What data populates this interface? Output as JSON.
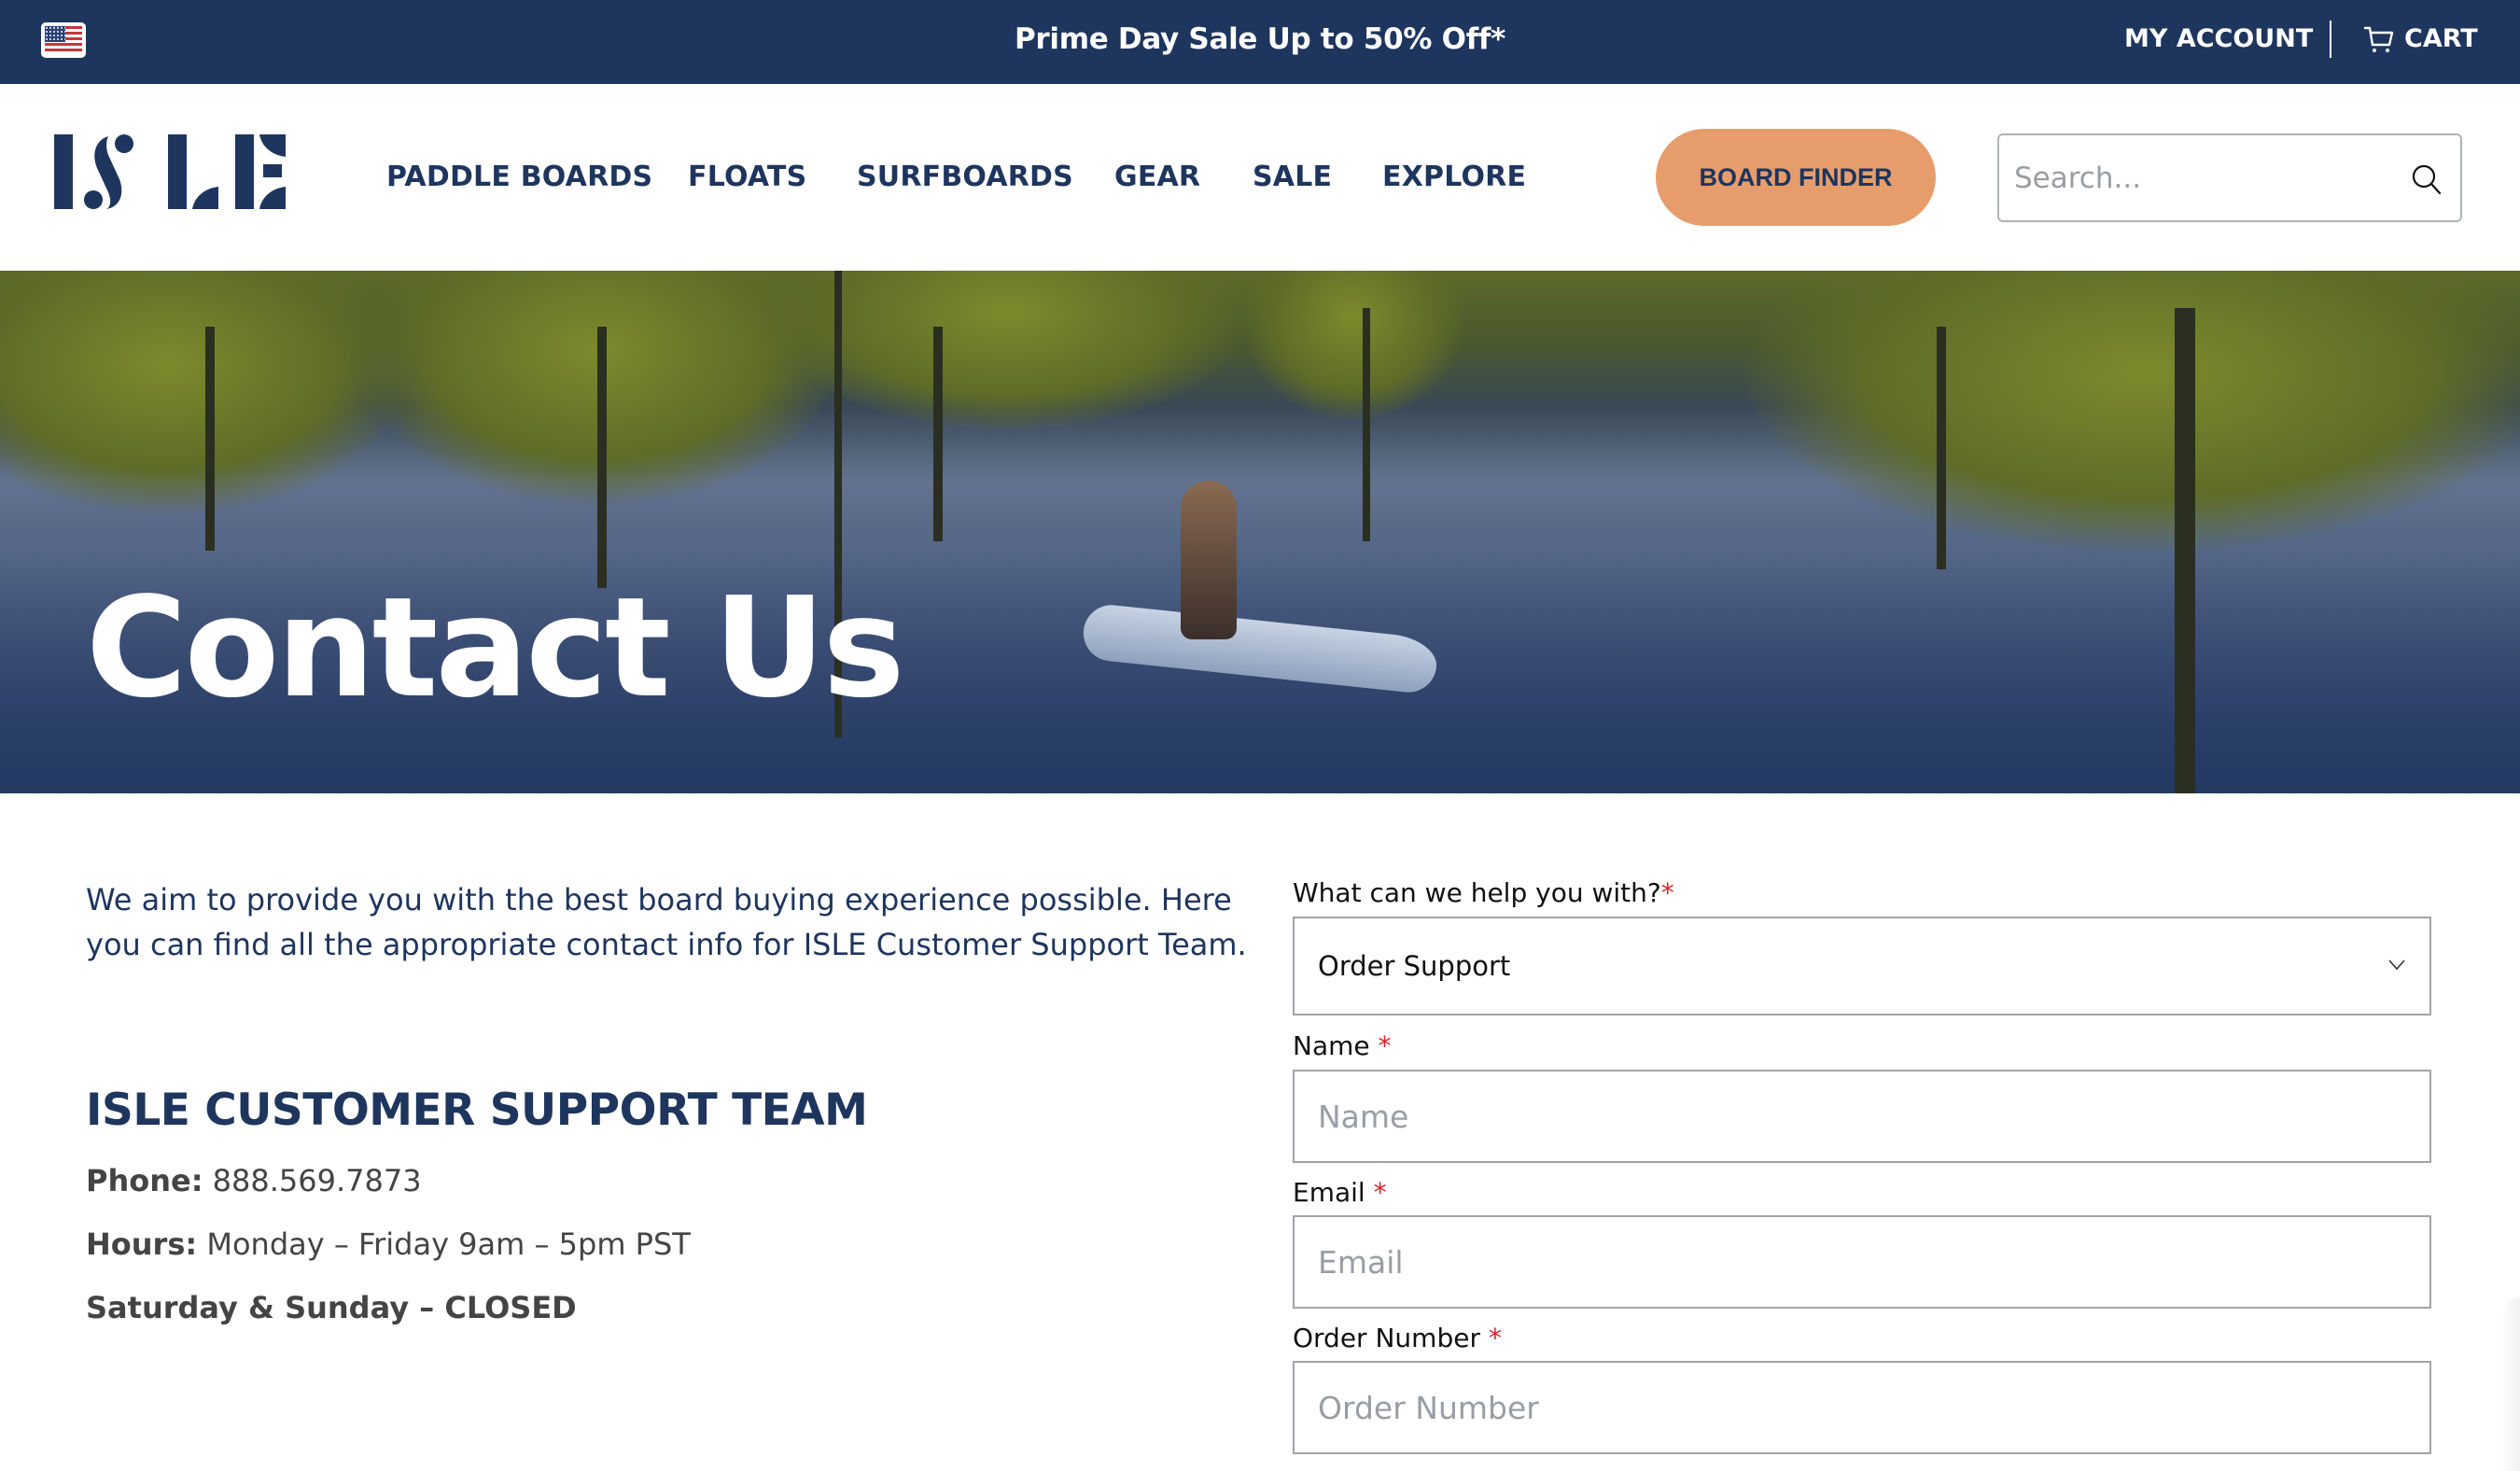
{
  "topbar": {
    "flag_icon": "us-flag-icon",
    "promo_text": "Prime Day Sale Up to 50% Off*",
    "my_account_label": "MY ACCOUNT",
    "cart_label": "CART",
    "cart_icon": "cart-icon"
  },
  "header": {
    "logo_text": "ISLE",
    "nav": [
      {
        "label": "PADDLE BOARDS"
      },
      {
        "label": "FLOATS"
      },
      {
        "label": "SURFBOARDS"
      },
      {
        "label": "GEAR"
      },
      {
        "label": "SALE"
      },
      {
        "label": "EXPLORE"
      }
    ],
    "board_finder_label": "BOARD FINDER",
    "search": {
      "placeholder": "Search...",
      "value": "",
      "icon": "search-icon"
    }
  },
  "hero": {
    "title": "Contact Us"
  },
  "intro": {
    "text": "We aim to provide you with the best board buying experience possible. Here you can find all the appropriate contact info for ISLE Customer Support Team."
  },
  "support": {
    "heading": "ISLE CUSTOMER SUPPORT TEAM",
    "phone_label": "Phone:",
    "phone_value": "888.569.7873",
    "hours_label": "Hours:",
    "hours_value": "Monday – Friday 9am – 5pm PST",
    "weekend": "Saturday & Sunday – CLOSED"
  },
  "form": {
    "help_label": "What can we help you with?",
    "help_selected": "Order Support",
    "required_mark": "*",
    "name_label": "Name",
    "name_placeholder": "Name",
    "email_label": "Email",
    "email_placeholder": "Email",
    "order_label": "Order Number",
    "order_placeholder": "Order Number"
  },
  "colors": {
    "brand_navy": "#1e355e",
    "accent_orange": "#e69d6b",
    "required_red": "#e0202a",
    "field_border": "#a3a3a8"
  }
}
